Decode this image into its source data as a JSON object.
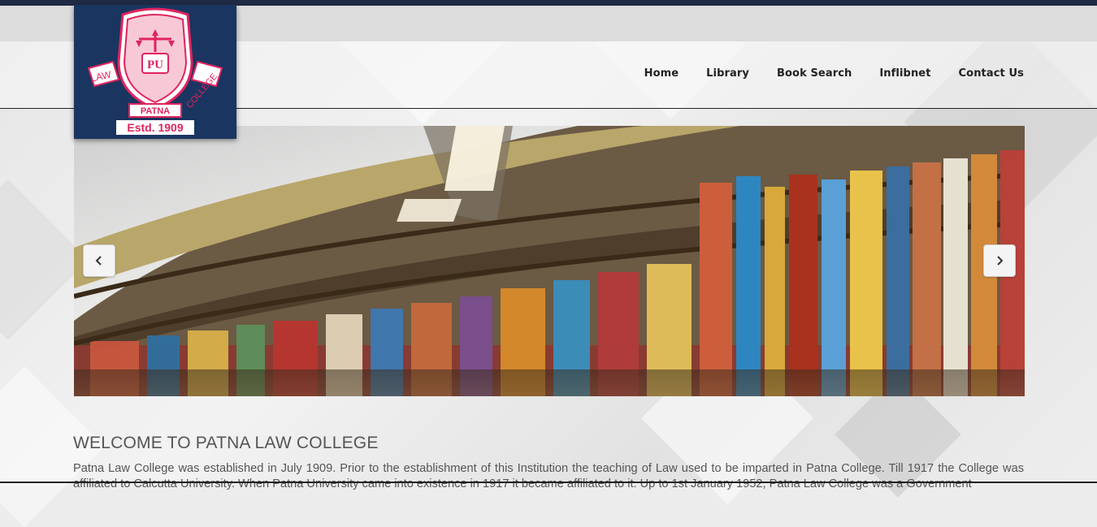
{
  "logo": {
    "seal_letters": "PU",
    "ribbon_left": "LAW",
    "ribbon_mid": "PATNA",
    "ribbon_right": "COLLEGE",
    "estd": "Estd. 1909"
  },
  "nav": {
    "items": [
      {
        "label": "Home"
      },
      {
        "label": "Library"
      },
      {
        "label": "Book Search"
      },
      {
        "label": "Inflibnet"
      },
      {
        "label": "Contact Us"
      }
    ]
  },
  "carousel": {
    "prev_icon": "chevron-left-icon",
    "next_icon": "chevron-right-icon"
  },
  "main": {
    "heading": "WELCOME TO PATNA LAW COLLEGE",
    "intro": "Patna Law College was established in July 1909. Prior to the establishment of this Institution the teaching of Law used to be imparted in Patna College. Till 1917 the College was affiliated to Calcutta University. When Patna University came into existence in 1917 it became affiliated to it. Up to 1st January 1952, Patna Law College was a Government"
  },
  "colors": {
    "topbar": "#1f2a44",
    "logo_bg": "#1a3560",
    "seal_red": "#e0245e"
  }
}
